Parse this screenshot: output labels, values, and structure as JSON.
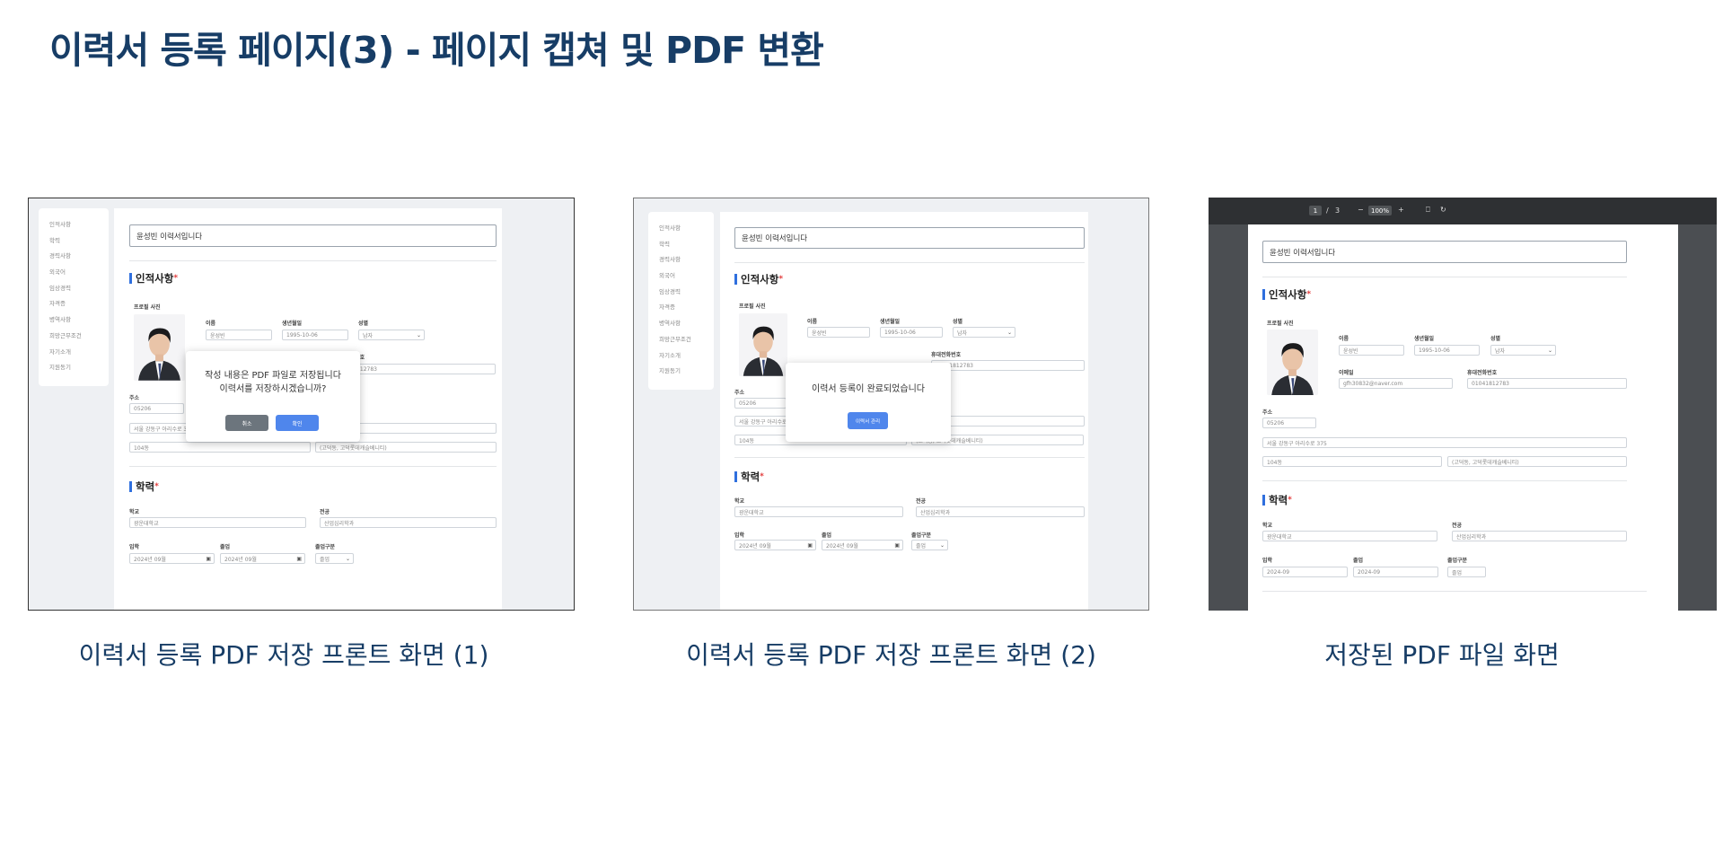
{
  "page": {
    "title": "이력서 등록 페이지(3) - 페이지 캡쳐 및 PDF 변환"
  },
  "captions": [
    "이력서 등록 PDF 저장 프론트 화면 (1)",
    "이력서 등록 PDF 저장 프론트 화면 (2)",
    "저장된 PDF 파일 화면"
  ],
  "form": {
    "sidebar": [
      "인적사항",
      "학력",
      "경력사항",
      "외국어",
      "임상경력",
      "자격증",
      "병역사항",
      "희망근무조건",
      "자기소개",
      "지원동기"
    ],
    "resume_title": "윤성빈 이력서입니다",
    "section_personal": "인적사항",
    "section_education": "학력",
    "required_mark": "*",
    "profile_photo_label": "프로필 사진",
    "name_label": "이름",
    "name_value": "윤성빈",
    "birth_label": "생년월일",
    "birth_value": "1995-10-06",
    "gender_label": "성별",
    "gender_value": "남자",
    "email_label": "이메일",
    "email_value": "gfh30832@naver.com",
    "phone_label": "휴대전화번호",
    "phone_value": "01041812783",
    "address_label": "주소",
    "zipcode": "05206",
    "address1": "서울 강동구 아리수로 375",
    "address2": "104동",
    "address3": "(고덕동, 고덕롯데캐슬베니티)",
    "school_label": "학교",
    "school_value": "광운대학교",
    "major_label": "전공",
    "major_value": "산업심리학과",
    "enter_label": "입학",
    "enter_value": "2024년 09월",
    "graduate_label": "졸업",
    "graduate_value": "2024년 09월",
    "grad_status_label": "졸업구분",
    "grad_status_value": "졸업",
    "calendar_icon_glyph": "▣",
    "select_arrow_glyph": "⌄"
  },
  "modal1": {
    "line1": "작성 내용은 PDF 파일로 저장됩니다",
    "line2": "이력서를 저장하시겠습니까?",
    "cancel": "취소",
    "confirm": "확인",
    "cancel_color": "#6c757d",
    "confirm_color": "#4f86ec"
  },
  "modal2": {
    "message": "이력서 등록이 완료되었습니다",
    "button": "이력서 관리",
    "button_color": "#4f86ec"
  },
  "pdf": {
    "page_current": "1",
    "page_separator": "/",
    "page_total": "3",
    "zoom_out": "−",
    "zoom": "100%",
    "zoom_in": "+",
    "fit_icon": "⎕",
    "rotate_icon": "↻",
    "enter_value": "2024-09",
    "graduate_value": "2024-09"
  },
  "colors": {
    "title": "#173d66",
    "accent": "#2f6fde",
    "required": "#e23b3b"
  }
}
